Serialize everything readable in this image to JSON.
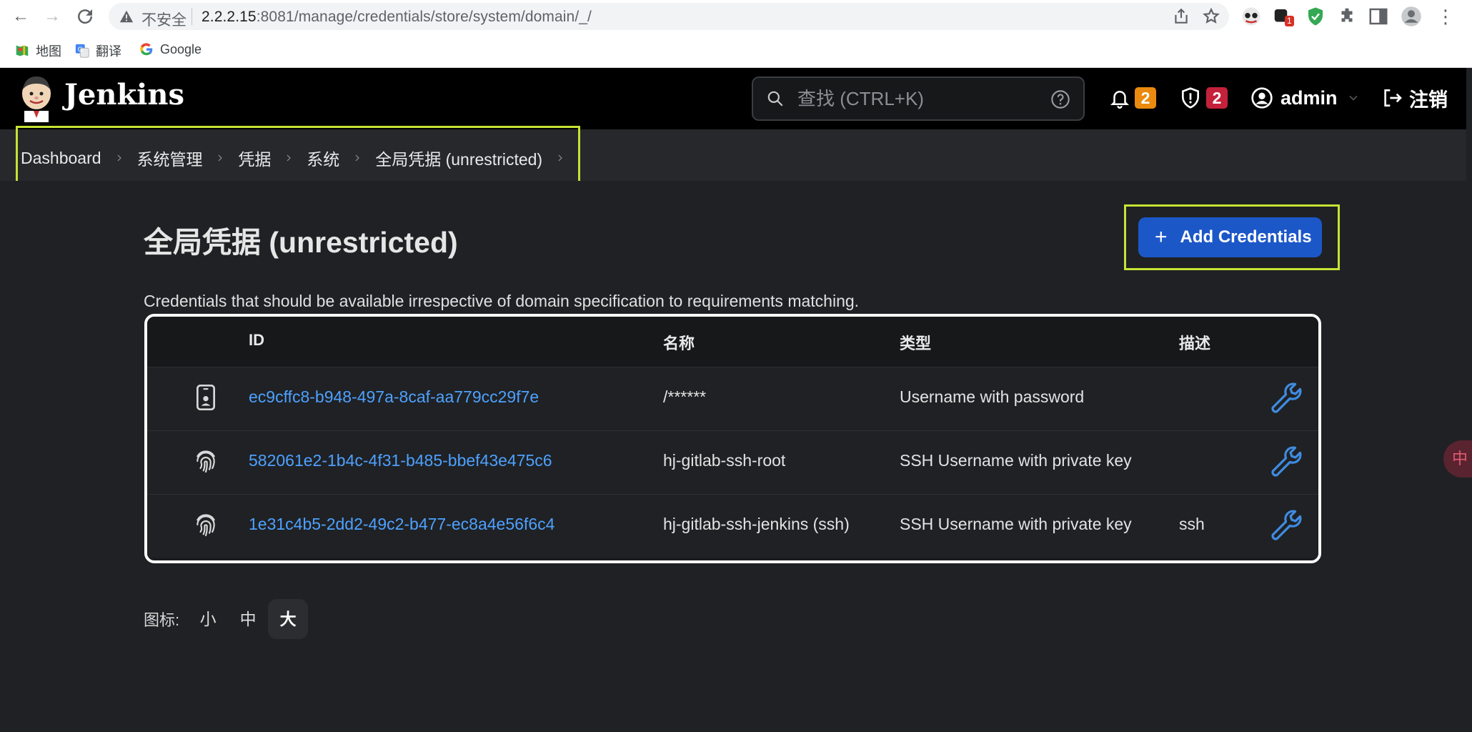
{
  "browser": {
    "insecure_label": "不安全",
    "url_host": "2.2.2.15",
    "url_rest": ":8081/manage/credentials/store/system/domain/_/",
    "ext_badge": "1",
    "bookmarks": [
      {
        "label": "地图",
        "icon": "maps-icon"
      },
      {
        "label": "翻译",
        "icon": "translate-icon"
      },
      {
        "label": "Google",
        "icon": "google-icon"
      }
    ]
  },
  "header": {
    "brand": "Jenkins",
    "search_placeholder": "查找 (CTRL+K)",
    "notifications_count": "2",
    "security_count": "2",
    "user": "admin",
    "logout": "注销"
  },
  "breadcrumb": [
    "Dashboard",
    "系统管理",
    "凭据",
    "系统",
    "全局凭据 (unrestricted)"
  ],
  "page": {
    "title": "全局凭据 (unrestricted)",
    "add_button": "Add Credentials",
    "description": "Credentials that should be available irrespective of domain specification to requirements matching."
  },
  "table": {
    "columns": [
      "ID",
      "名称",
      "类型",
      "描述"
    ],
    "rows": [
      {
        "icon": "id-card-icon",
        "id": "ec9cffc8-b948-497a-8caf-aa779cc29f7e",
        "name": "/******",
        "type": "Username with password",
        "desc": ""
      },
      {
        "icon": "fingerprint-icon",
        "id": "582061e2-1b4c-4f31-b485-bbef43e475c6",
        "name": "hj-gitlab-ssh-root",
        "type": "SSH Username with private key",
        "desc": ""
      },
      {
        "icon": "fingerprint-icon",
        "id": "1e31c4b5-2dd2-49c2-b477-ec8a4e56f6c4",
        "name": "hj-gitlab-ssh-jenkins (ssh)",
        "type": "SSH Username with private key",
        "desc": "ssh"
      }
    ]
  },
  "icon_size": {
    "label": "图标:",
    "options": [
      "小",
      "中",
      "大"
    ],
    "selected": "大"
  },
  "floating_label": "中",
  "colors": {
    "accent": "#1c57c8",
    "highlight": "#c7e235",
    "link": "#4ea1ff",
    "badge_orange": "#ea8a0e",
    "badge_red": "#c3223a"
  }
}
